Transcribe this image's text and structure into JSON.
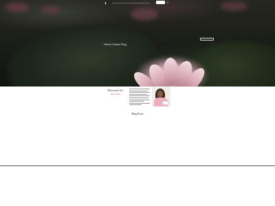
{
  "header": {
    "logo_icon": "lotus-logo-icon",
    "menu_icon": "hamburger-icon",
    "menu_glyph": "≡"
  },
  "hero": {
    "title": "Nneti's Garden Blog"
  },
  "about": {
    "name": "Blossoms Are",
    "subtitle": "Everywhere"
  },
  "blog": {
    "section_title": "Blog Posts"
  }
}
